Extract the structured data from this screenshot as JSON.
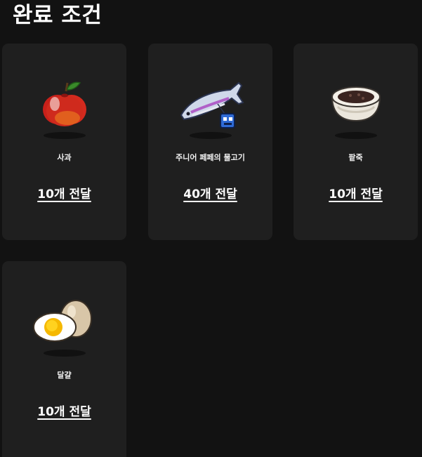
{
  "title": "완료 조건",
  "items": [
    {
      "icon": "apple-icon",
      "name": "사과",
      "requirement": "10개 전달"
    },
    {
      "icon": "fish-icon",
      "name": "주니어 페페의 물고기",
      "requirement": "40개 전달"
    },
    {
      "icon": "red-bean-porridge-icon",
      "name": "팥죽",
      "requirement": "10개 전달"
    },
    {
      "icon": "boiled-egg-icon",
      "name": "달걀",
      "requirement": "10개 전달"
    }
  ]
}
